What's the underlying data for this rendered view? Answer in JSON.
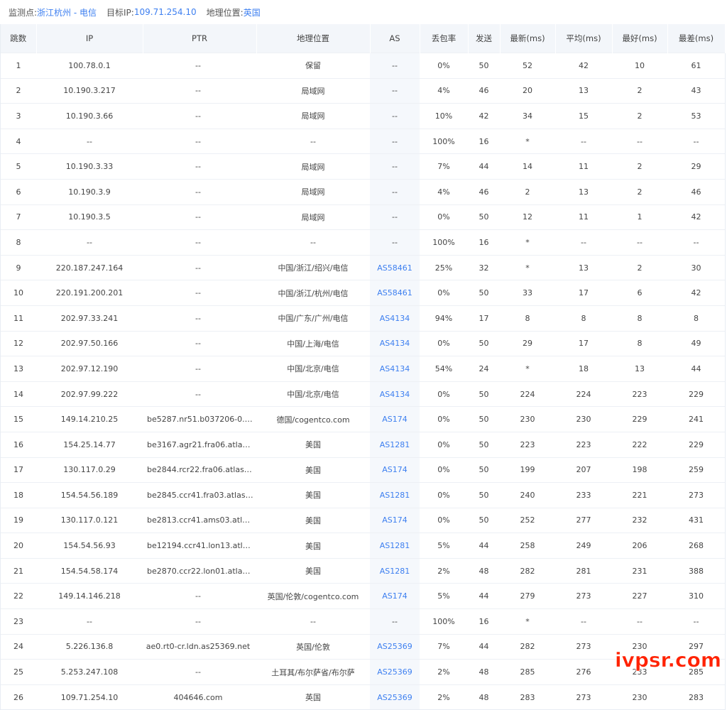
{
  "header": {
    "monitor_label": "监测点:",
    "monitor_value": "浙江杭州 - 电信",
    "target_label": "目标IP:",
    "target_value": "109.71.254.10",
    "geo_label": "地理位置:",
    "geo_value": "英国"
  },
  "columns": [
    "跳数",
    "IP",
    "PTR",
    "地理位置",
    "AS",
    "丢包率",
    "发送",
    "最新(ms)",
    "平均(ms)",
    "最好(ms)",
    "最差(ms)"
  ],
  "rows": [
    [
      "1",
      "100.78.0.1",
      "--",
      "保留",
      "--",
      "0%",
      "50",
      "52",
      "42",
      "10",
      "61"
    ],
    [
      "2",
      "10.190.3.217",
      "--",
      "局域网",
      "--",
      "4%",
      "46",
      "20",
      "13",
      "2",
      "43"
    ],
    [
      "3",
      "10.190.3.66",
      "--",
      "局域网",
      "--",
      "10%",
      "42",
      "34",
      "15",
      "2",
      "53"
    ],
    [
      "4",
      "--",
      "--",
      "--",
      "--",
      "100%",
      "16",
      "*",
      "--",
      "--",
      "--"
    ],
    [
      "5",
      "10.190.3.33",
      "--",
      "局域网",
      "--",
      "7%",
      "44",
      "14",
      "11",
      "2",
      "29"
    ],
    [
      "6",
      "10.190.3.9",
      "--",
      "局域网",
      "--",
      "4%",
      "46",
      "2",
      "13",
      "2",
      "46"
    ],
    [
      "7",
      "10.190.3.5",
      "--",
      "局域网",
      "--",
      "0%",
      "50",
      "12",
      "11",
      "1",
      "42"
    ],
    [
      "8",
      "--",
      "--",
      "--",
      "--",
      "100%",
      "16",
      "*",
      "--",
      "--",
      "--"
    ],
    [
      "9",
      "220.187.247.164",
      "--",
      "中国/浙江/绍兴/电信",
      "AS58461",
      "25%",
      "32",
      "*",
      "13",
      "2",
      "30"
    ],
    [
      "10",
      "220.191.200.201",
      "--",
      "中国/浙江/杭州/电信",
      "AS58461",
      "0%",
      "50",
      "33",
      "17",
      "6",
      "42"
    ],
    [
      "11",
      "202.97.33.241",
      "--",
      "中国/广东/广州/电信",
      "AS4134",
      "94%",
      "17",
      "8",
      "8",
      "8",
      "8"
    ],
    [
      "12",
      "202.97.50.166",
      "--",
      "中国/上海/电信",
      "AS4134",
      "0%",
      "50",
      "29",
      "17",
      "8",
      "49"
    ],
    [
      "13",
      "202.97.12.190",
      "--",
      "中国/北京/电信",
      "AS4134",
      "54%",
      "24",
      "*",
      "18",
      "13",
      "44"
    ],
    [
      "14",
      "202.97.99.222",
      "--",
      "中国/北京/电信",
      "AS4134",
      "0%",
      "50",
      "224",
      "224",
      "223",
      "229"
    ],
    [
      "15",
      "149.14.210.25",
      "be5287.nr51.b037206-0.fra0...",
      "德国/cogentco.com",
      "AS174",
      "0%",
      "50",
      "230",
      "230",
      "229",
      "241"
    ],
    [
      "16",
      "154.25.14.77",
      "be3167.agr21.fra06.atlas.cog...",
      "美国",
      "AS1281",
      "0%",
      "50",
      "223",
      "223",
      "222",
      "229"
    ],
    [
      "17",
      "130.117.0.29",
      "be2844.rcr22.fra06.atlas.cog...",
      "美国",
      "AS174",
      "0%",
      "50",
      "199",
      "207",
      "198",
      "259"
    ],
    [
      "18",
      "154.54.56.189",
      "be2845.ccr41.fra03.atlas.cog...",
      "美国",
      "AS1281",
      "0%",
      "50",
      "240",
      "233",
      "221",
      "273"
    ],
    [
      "19",
      "130.117.0.121",
      "be2813.ccr41.ams03.atlas.co...",
      "美国",
      "AS174",
      "0%",
      "50",
      "252",
      "277",
      "232",
      "431"
    ],
    [
      "20",
      "154.54.56.93",
      "be12194.ccr41.lon13.atlas.co...",
      "美国",
      "AS1281",
      "5%",
      "44",
      "258",
      "249",
      "206",
      "268"
    ],
    [
      "21",
      "154.54.58.174",
      "be2870.ccr22.lon01.atlas.cog...",
      "美国",
      "AS1281",
      "2%",
      "48",
      "282",
      "281",
      "231",
      "388"
    ],
    [
      "22",
      "149.14.146.218",
      "--",
      "英国/伦敦/cogentco.com",
      "AS174",
      "5%",
      "44",
      "279",
      "273",
      "227",
      "310"
    ],
    [
      "23",
      "--",
      "--",
      "--",
      "--",
      "100%",
      "16",
      "*",
      "--",
      "--",
      "--"
    ],
    [
      "24",
      "5.226.136.8",
      "ae0.rt0-cr.ldn.as25369.net",
      "英国/伦敦",
      "AS25369",
      "7%",
      "44",
      "282",
      "273",
      "230",
      "297"
    ],
    [
      "25",
      "5.253.247.108",
      "--",
      "土耳其/布尔萨省/布尔萨",
      "AS25369",
      "2%",
      "48",
      "285",
      "276",
      "233",
      "285"
    ],
    [
      "26",
      "109.71.254.10",
      "404646.com",
      "英国",
      "AS25369",
      "2%",
      "48",
      "283",
      "273",
      "230",
      "283"
    ]
  ],
  "watermark": "ivpsr.com",
  "colors": {
    "accent": "#3d7ff0",
    "header_bg": "#f3f6fa",
    "watermark": "#ff2200"
  }
}
